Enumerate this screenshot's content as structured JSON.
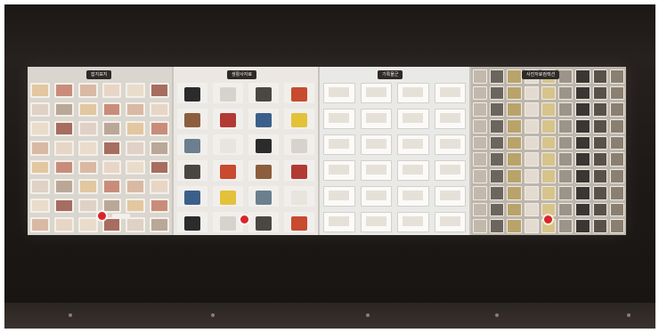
{
  "panels": [
    {
      "id": "p1",
      "title": "잡지표지",
      "bg": "#d9d5cf"
    },
    {
      "id": "p2",
      "title": "생활사자료",
      "bg": "#ebe8e4"
    },
    {
      "id": "p3",
      "title": "기록물군",
      "bg": "#e9e9e7"
    },
    {
      "id": "p4",
      "title": "사진자료컴렉션",
      "bg": "#bdb6ad"
    }
  ],
  "colors": {
    "marker": "#d8252a",
    "magazine_tones": [
      "#e7d6c6",
      "#d9b9a4",
      "#c98c7a",
      "#e2c7a0",
      "#b9a898",
      "#dfd1c5",
      "#a66d60",
      "#e9dccb"
    ],
    "object_tones": [
      "#c84a2f",
      "#2b2b2b",
      "#e3c23a",
      "#8c5e3c",
      "#d7d3cc",
      "#6b7f8f",
      "#b23a34",
      "#4a4743",
      "#e8e4de",
      "#3b5f8a"
    ],
    "document_tones": [
      "#f2efe9",
      "#ded6c7",
      "#e6e1d8",
      "#c9b69c",
      "#f7f5f1"
    ],
    "photo_tones": [
      "#3a3632",
      "#6b655d",
      "#9c9488",
      "#c2b9ac",
      "#d8c48a",
      "#8a7f70",
      "#e3dbcf",
      "#57514a",
      "#b8a36a"
    ]
  }
}
